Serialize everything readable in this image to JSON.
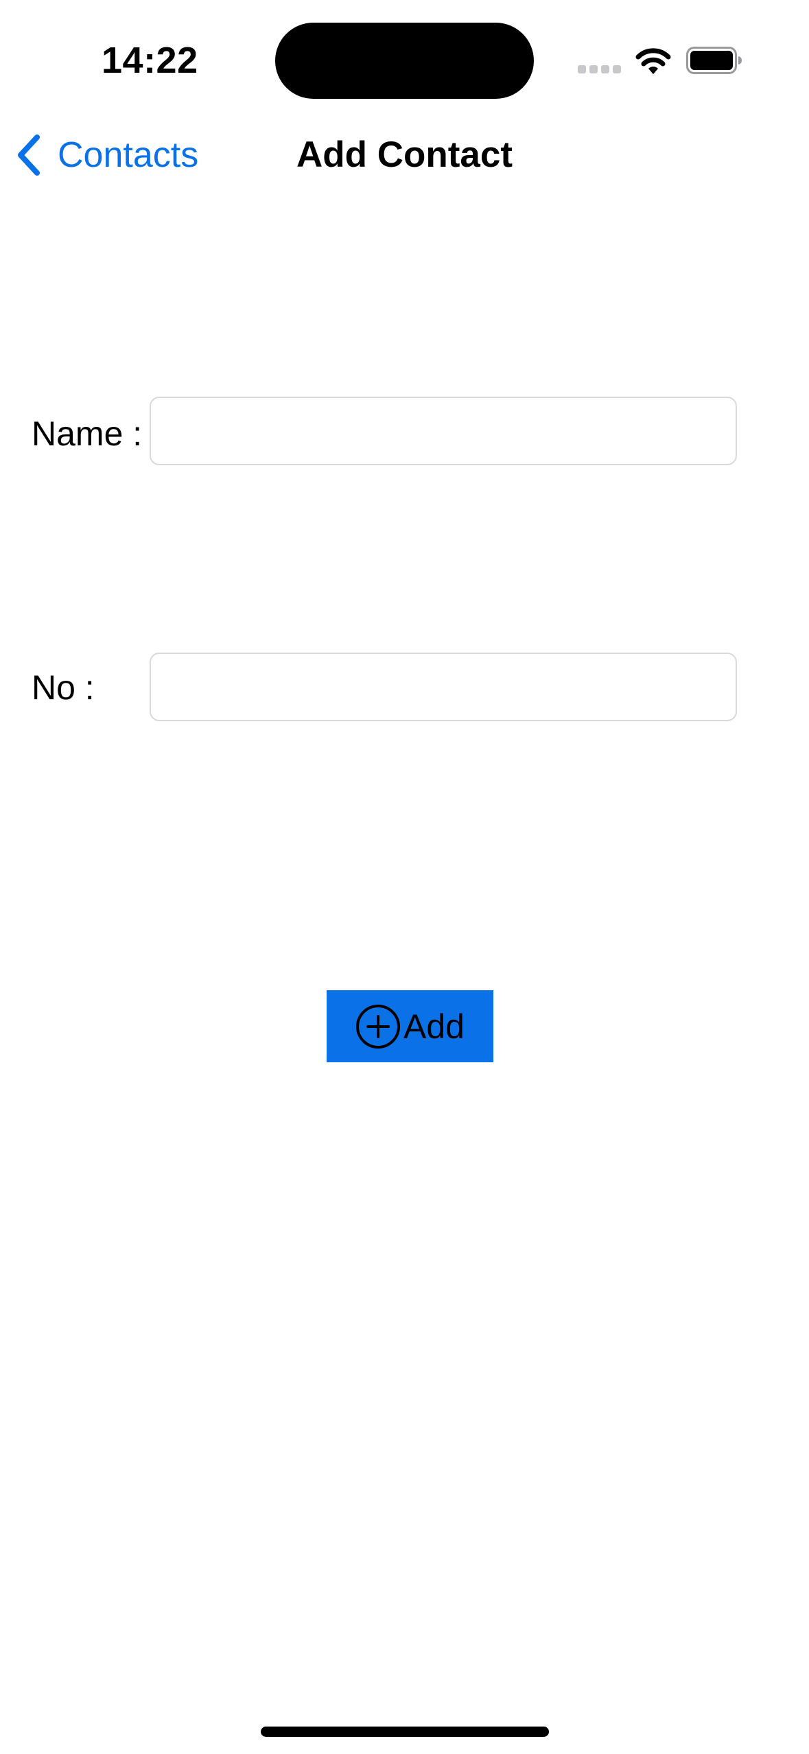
{
  "status_bar": {
    "time": "14:22",
    "icons": [
      "cellular-signal-icon",
      "wifi-icon",
      "battery-icon"
    ]
  },
  "nav": {
    "back_label": "Contacts",
    "title": "Add Contact",
    "accent_color": "#0a72e6"
  },
  "form": {
    "name_label": "Name :",
    "name_value": "",
    "name_placeholder": "",
    "number_label": "No :",
    "number_value": "",
    "number_placeholder": ""
  },
  "add_button": {
    "icon": "plus-circle-icon",
    "label": "Add",
    "background_color": "#0a72e6"
  }
}
